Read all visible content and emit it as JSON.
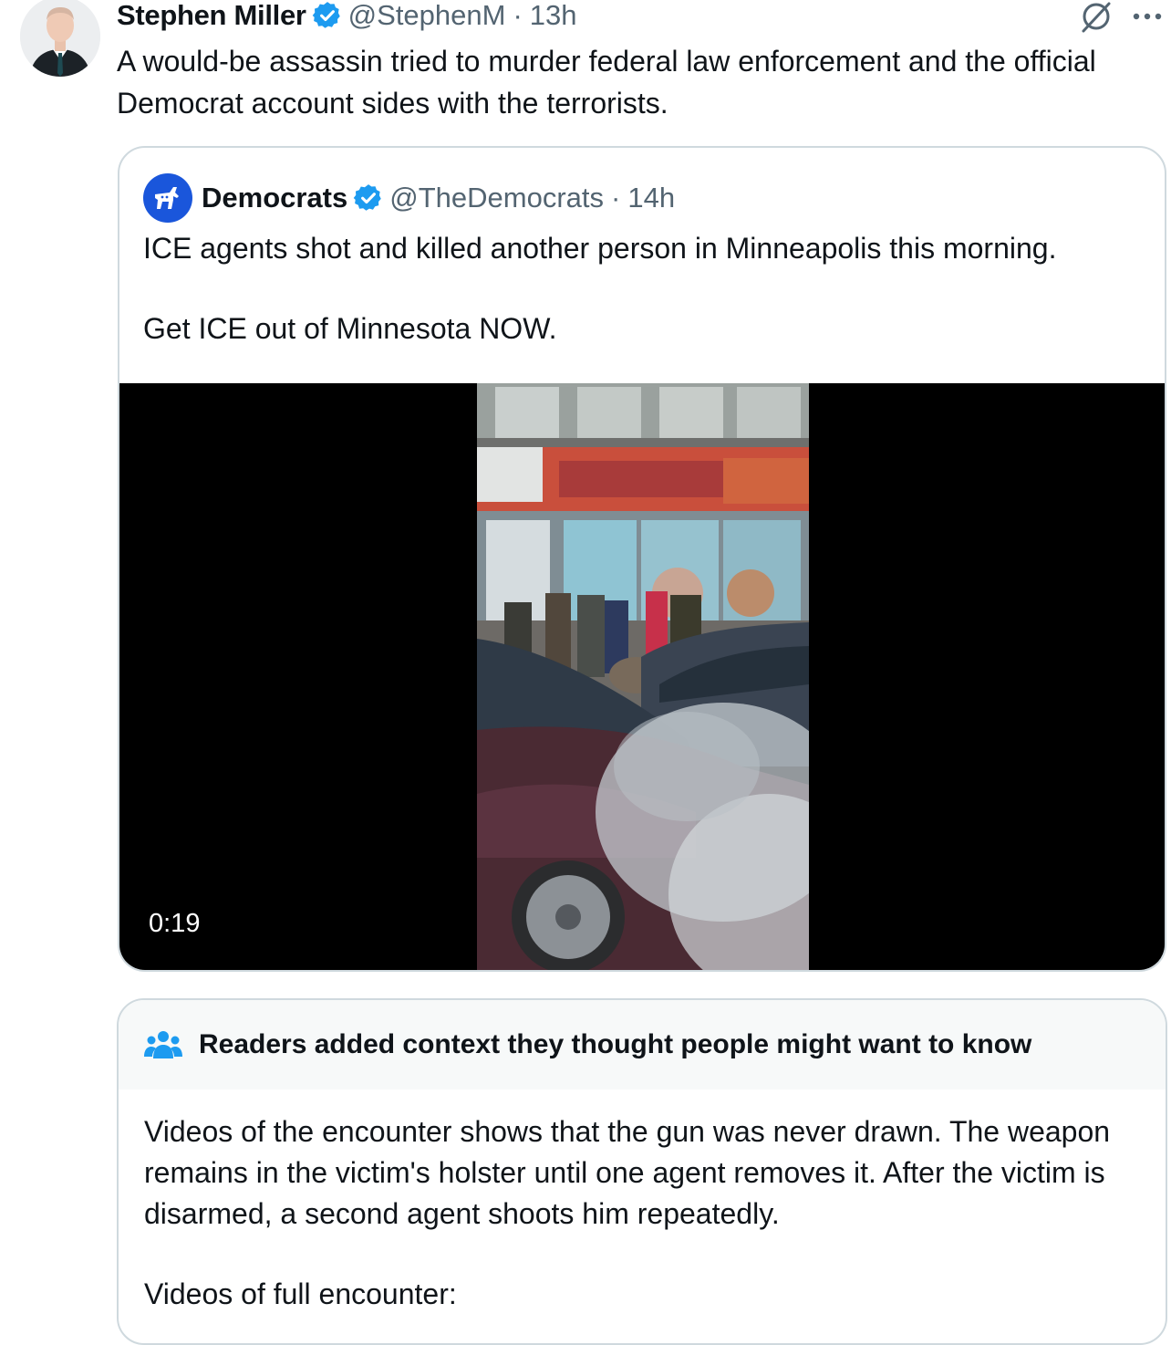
{
  "post": {
    "author_name": "Stephen Miller",
    "handle": "@StephenM",
    "separator": "·",
    "time": "13h",
    "text": "A would-be assassin tried to murder federal law enforcement and the official Democrat account sides with the terrorists.",
    "icons": {
      "verified": "verified-badge-icon",
      "grok": "grok-icon",
      "more": "more-options-icon"
    }
  },
  "quote": {
    "author_name": "Democrats",
    "handle": "@TheDemocrats",
    "separator": "·",
    "time": "14h",
    "text_line1": "ICE agents shot and killed another person in Minneapolis this morning.",
    "text_line2": "Get ICE out of Minnesota NOW.",
    "video": {
      "duration": "0:19"
    }
  },
  "community_note": {
    "title": "Readers added context they thought people might want to know",
    "body_para1": "Videos of the encounter shows that the gun was never drawn. The weapon remains in the victim's holster until one agent removes it. After the victim is disarmed, a second agent shoots him repeatedly.",
    "body_para2": "Videos of full encounter:"
  },
  "colors": {
    "text": "#0f1419",
    "secondary": "#536471",
    "border": "#cfd9de",
    "verified_blue": "#1d9bf0",
    "democrats_blue": "#1a56db",
    "note_bg": "#f7f9f9"
  }
}
